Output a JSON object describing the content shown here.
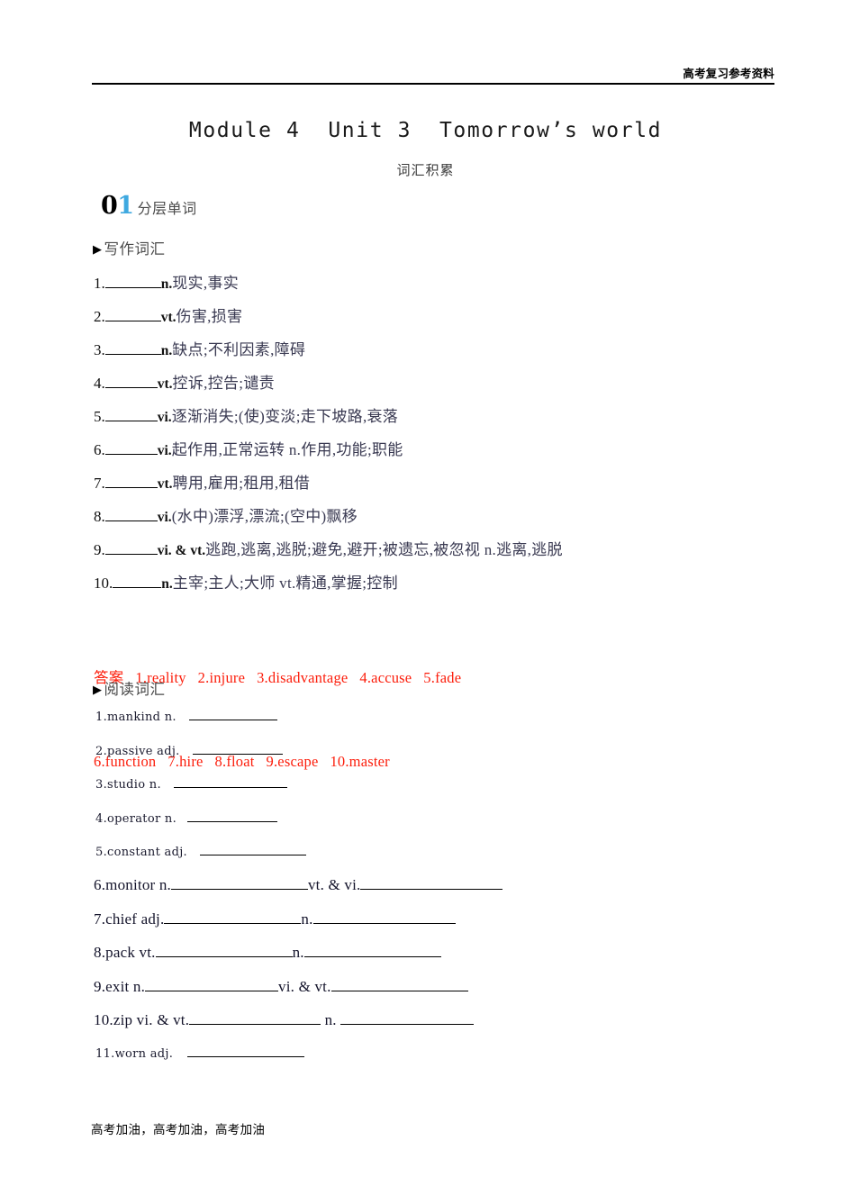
{
  "header": {
    "right_text": "高考复习参考资料"
  },
  "title": "Module 4  Unit 3  Tomorrow’s world",
  "subtitle": "词汇积累",
  "section": {
    "number_first": "0",
    "number_second": "1",
    "label": "分层单词"
  },
  "groups": {
    "writing": {
      "marker": "▶",
      "label": "写作词汇"
    },
    "reading": {
      "marker": "▶",
      "label": "阅读词汇"
    }
  },
  "writing_words": [
    {
      "index": "1.",
      "pos": "n.",
      "meaning": "现实,事实",
      "blank_width": 62
    },
    {
      "index": "2.",
      "pos": "vt.",
      "meaning": "伤害,损害",
      "blank_width": 62
    },
    {
      "index": "3.",
      "pos": "n.",
      "meaning": "缺点;不利因素,障碍",
      "blank_width": 62
    },
    {
      "index": "4.",
      "pos": "vt.",
      "meaning": "控诉,控告;谴责",
      "blank_width": 58
    },
    {
      "index": "5.",
      "pos": "vi.",
      "meaning": "逐渐消失;(使)变淡;走下坡路,衰落",
      "blank_width": 58
    },
    {
      "index": "6.",
      "pos": "vi.",
      "meaning": "起作用,正常运转 n.作用,功能;职能",
      "blank_width": 58
    },
    {
      "index": "7.",
      "pos": "vt.",
      "meaning": "聘用,雇用;租用,租借",
      "blank_width": 58
    },
    {
      "index": "8.",
      "pos": "vi.",
      "meaning": "(水中)漂浮,漂流;(空中)飘移",
      "blank_width": 58
    },
    {
      "index": "9.",
      "pos": "vi. & vt.",
      "meaning": "逃跑,逃离,逃脱;避免,避开;被遗忘,被忽视  n.逃离,逃脱",
      "blank_width": 58
    },
    {
      "index": "10.",
      "pos": "n.",
      "meaning": "主宰;主人;大师 vt.精通,掌握;控制",
      "blank_width": 54
    }
  ],
  "answers": {
    "label": "答案",
    "line1": "答案   1.reality   2.injure   3.disadvantage   4.accuse   5.fade",
    "line2": "6.function   7.hire   8.float   9.escape   10.master",
    "items": [
      {
        "index": "1.",
        "word": "reality"
      },
      {
        "index": "2.",
        "word": "injure"
      },
      {
        "index": "3.",
        "word": "disadvantage"
      },
      {
        "index": "4.",
        "word": "accuse"
      },
      {
        "index": "5.",
        "word": "fade"
      },
      {
        "index": "6.",
        "word": "function"
      },
      {
        "index": "7.",
        "word": "hire"
      },
      {
        "index": "8.",
        "word": "float"
      },
      {
        "index": "9.",
        "word": "escape"
      },
      {
        "index": "10.",
        "word": "master"
      }
    ]
  },
  "reading_words_small": [
    {
      "text": "1.mankind n.",
      "blank1": 98,
      "gap": 14
    },
    {
      "text": "2.passive adj.",
      "blank1": 100,
      "gap": 14
    },
    {
      "text": "3.studio n.",
      "blank1": 126,
      "gap": 14
    },
    {
      "text": "4.operator n.",
      "blank1": 100,
      "gap": 12
    },
    {
      "text": "5.constant adj.",
      "blank1": 118,
      "gap": 14
    }
  ],
  "reading_words_big": [
    {
      "label1": "6.monitor n.",
      "blank1": 152,
      "label2": "vt. & vi.",
      "blank2": 158
    },
    {
      "label1": "7.chief adj.",
      "blank1": 152,
      "label2": "n.",
      "blank2": 158
    },
    {
      "label1": "8.pack vt.",
      "blank1": 152,
      "label2": "n.",
      "blank2": 152
    },
    {
      "label1": "9.exit n.",
      "blank1": 148,
      "label2": "vi. & vt.",
      "blank2": 152
    },
    {
      "label1": "10.zip vi. & vt.",
      "blank1": 146,
      "label2": " n. ",
      "blank2": 148
    }
  ],
  "reading_words_last": [
    {
      "text": "11.worn adj.",
      "blank1": 130,
      "gap": 16
    }
  ],
  "footer": {
    "text": "高考加油，高考加油，高考加油"
  },
  "colors": {
    "answer_red": "#fc1d0b",
    "section_digit_blue": "#3fa9e0",
    "body_text": "#34344a"
  }
}
